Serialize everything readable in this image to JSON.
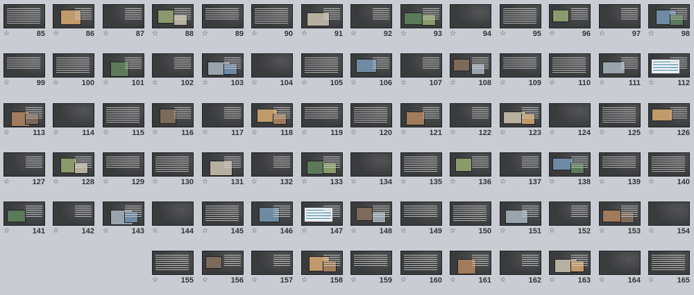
{
  "rows": [
    {
      "slides": [
        "98",
        "97",
        "96",
        "95",
        "94",
        "93",
        "92",
        "91",
        "90",
        "89",
        "88",
        "87",
        "86",
        "85"
      ]
    },
    {
      "slides": [
        "112",
        "111",
        "110",
        "109",
        "108",
        "107",
        "106",
        "105",
        "104",
        "103",
        "102",
        "101",
        "100",
        "99"
      ]
    },
    {
      "slides": [
        "126",
        "125",
        "124",
        "123",
        "122",
        "121",
        "120",
        "119",
        "118",
        "117",
        "116",
        "115",
        "114",
        "113"
      ]
    },
    {
      "slides": [
        "140",
        "139",
        "138",
        "137",
        "136",
        "135",
        "134",
        "133",
        "132",
        "131",
        "130",
        "129",
        "128",
        "127"
      ]
    },
    {
      "slides": [
        "154",
        "153",
        "152",
        "151",
        "150",
        "149",
        "148",
        "147",
        "146",
        "145",
        "144",
        "143",
        "142",
        "141"
      ]
    },
    {
      "slides": [
        "165",
        "164",
        "163",
        "162",
        "161",
        "160",
        "159",
        "158",
        "157",
        "156",
        "155"
      ]
    }
  ],
  "transition_icon": "slide-transition-star-icon",
  "colors": {
    "workspace": "#c9cdd3",
    "slide_bg": "#3a3b3d",
    "number": "#333333"
  }
}
